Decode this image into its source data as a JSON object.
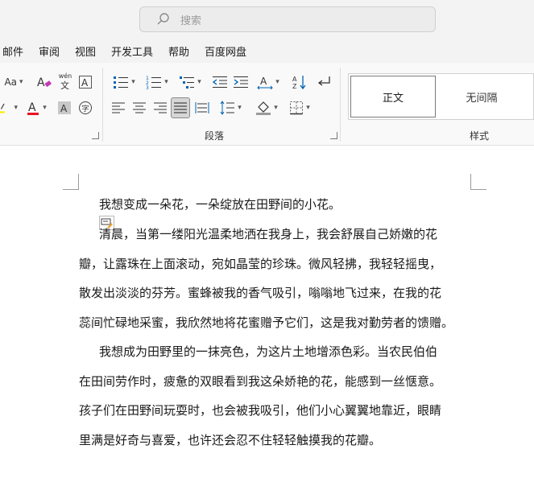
{
  "search": {
    "placeholder": "搜索"
  },
  "menu": [
    "邮件",
    "审阅",
    "视图",
    "开发工具",
    "帮助",
    "百度网盘"
  ],
  "ribbon": {
    "font_size_label": "Aa",
    "pinyin_label": "wén",
    "groups": {
      "paragraph": "段落",
      "styles": "样式"
    },
    "styles": {
      "normal": "正文",
      "no_spacing": "无间隔"
    }
  },
  "document": {
    "lines": [
      "我想变成一朵花，一朵绽放在田野间的小花。",
      "清晨，当第一缕阳光温柔地洒在我身上，我会舒展自己娇嫩的花",
      "瓣，让露珠在上面滚动，宛如晶莹的珍珠。微风轻拂，我轻轻摇曳，",
      "散发出淡淡的芬芳。蜜蜂被我的香气吸引，嗡嗡地飞过来，在我的花",
      "蕊间忙碌地采蜜，我欣然地将花蜜赠予它们，这是我对勤劳者的馈赠。",
      "我想成为田野里的一抹亮色，为这片土地增添色彩。当农民伯伯",
      "在田间劳作时，疲惫的双眼看到我这朵娇艳的花，能感到一丝惬意。",
      "孩子们在田野间玩耍时，也会被我吸引，他们小心翼翼地靠近，眼睛",
      "里满是好奇与喜爱，也许还会忍不住轻轻触摸我的花瓣。"
    ]
  },
  "colors": {
    "highlight": "#ffeb00",
    "font_color": "#e81123",
    "selected_button": "#d6d6d6"
  }
}
